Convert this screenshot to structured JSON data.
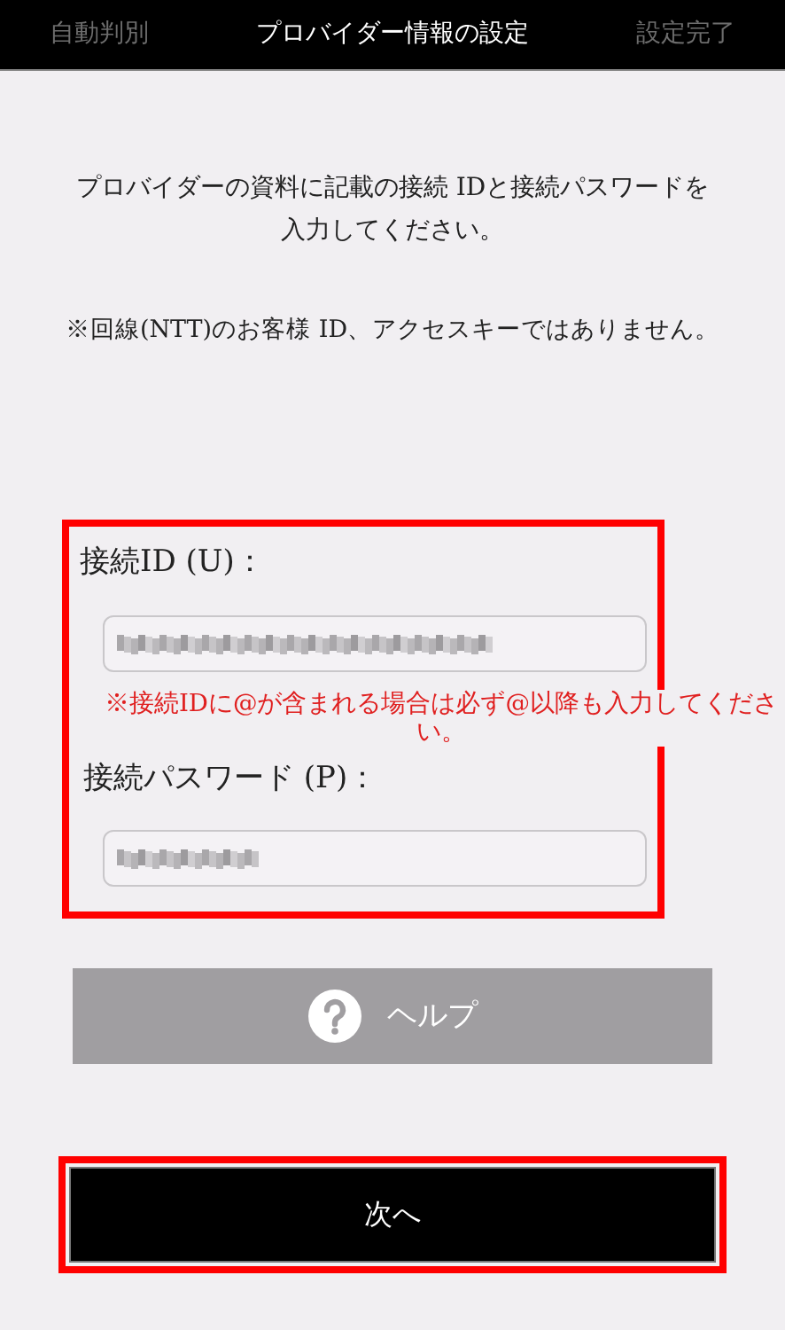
{
  "steps": [
    {
      "label": "自動判別",
      "selected": false
    },
    {
      "label": "プロバイダー情報の設定",
      "selected": true
    },
    {
      "label": "設定完了",
      "selected": false
    }
  ],
  "intro": "プロバイダーの資料に記載の接続 IDと接続パスワードを入力してください。",
  "notice": "※回線(NTT)のお客様 ID、アクセスキーではありません。",
  "form": {
    "highlighted": true,
    "id_label": "接続ID (U)：",
    "id_warning": "※接続IDに@が含まれる場合は必ず@以降も入力してください。",
    "password_label": "接続パスワード (P)："
  },
  "help_button": {
    "label": "ヘルプ"
  },
  "next_button": {
    "label": "次へ",
    "highlighted": true
  }
}
